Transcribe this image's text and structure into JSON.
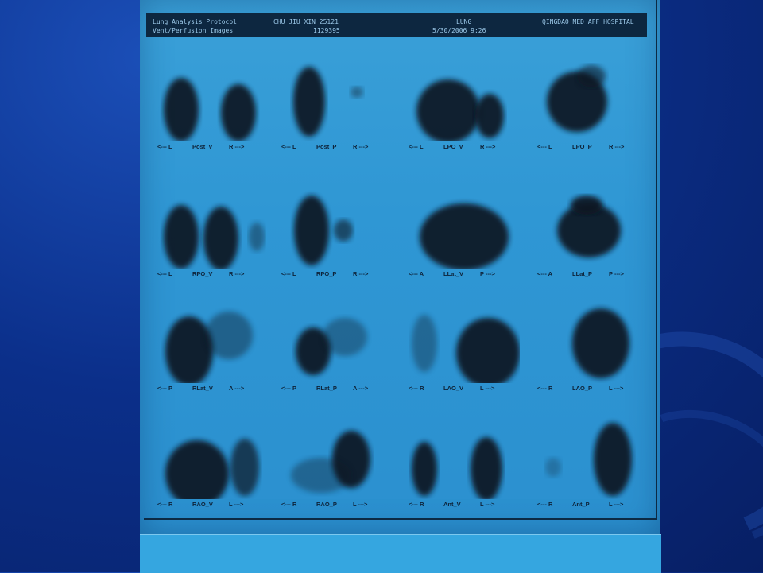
{
  "header": {
    "protocol_line1": "Lung Analysis Protocol",
    "protocol_line2": "Vent/Perfusion Images",
    "patient_line1": "CHU JIU XIN 25121",
    "patient_line2": "1129395",
    "study": "LUNG",
    "datetime": "5/30/2006 9:26",
    "hospital": "QINGDAO MED AFF HOSPITAL"
  },
  "panels": [
    {
      "left": "<--- L",
      "view": "Post_V",
      "right": "R --->"
    },
    {
      "left": "<--- L",
      "view": "Post_P",
      "right": "R --->"
    },
    {
      "left": "<--- L",
      "view": "LPO_V",
      "right": "R --->"
    },
    {
      "left": "<--- L",
      "view": "LPO_P",
      "right": "R --->"
    },
    {
      "left": "<--- L",
      "view": "RPO_V",
      "right": "R --->"
    },
    {
      "left": "<--- L",
      "view": "RPO_P",
      "right": "R --->"
    },
    {
      "left": "<--- A",
      "view": "LLat_V",
      "right": "P --->"
    },
    {
      "left": "<--- A",
      "view": "LLat_P",
      "right": "P --->"
    },
    {
      "left": "<--- P",
      "view": "RLat_V",
      "right": "A --->"
    },
    {
      "left": "<--- P",
      "view": "RLat_P",
      "right": "A --->"
    },
    {
      "left": "<--- R",
      "view": "LAO_V",
      "right": "L --->"
    },
    {
      "left": "<--- R",
      "view": "LAO_P",
      "right": "L --->"
    },
    {
      "left": "<--- R",
      "view": "RAO_V",
      "right": "L --->"
    },
    {
      "left": "<--- R",
      "view": "RAO_P",
      "right": "L --->"
    },
    {
      "left": "<--- R",
      "view": "Ant_V",
      "right": "L --->"
    },
    {
      "left": "<--- R",
      "view": "Ant_P",
      "right": "L --->"
    }
  ],
  "colors": {
    "film": "#2f97d4",
    "uptake": "#0a1622",
    "header_bg": "#0d2740",
    "background": "#0b2f8a"
  }
}
